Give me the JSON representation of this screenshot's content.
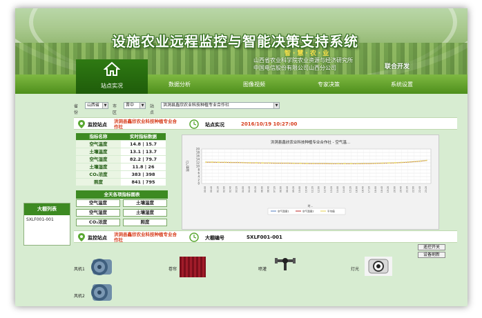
{
  "header": {
    "title": "设施农业远程监控与智能决策支持系统",
    "slogan": "智·慧·农·业",
    "org_line1": "山西省农业科学院农业资源与经济研究所",
    "org_line2": "中国电信股份有限公司山西分公司",
    "org_line3": "联合开发"
  },
  "nav": {
    "tabs": [
      {
        "label": "站点实况"
      },
      {
        "label": "数据分析"
      },
      {
        "label": "图像视频"
      },
      {
        "label": "专家决策"
      },
      {
        "label": "系统设置"
      }
    ]
  },
  "filters": {
    "province_label": "省份",
    "province_value": "山西省",
    "city_label": "市区",
    "city_value": "晋中",
    "site_label": "站点",
    "site_value": "洪洞县鑫欣农业科技种植专业合作社"
  },
  "monitor1": {
    "label": "监控站点",
    "site": "洪洞县鑫欣农业科技种植专业合作社",
    "live_label": "站点实况",
    "time": "2016/10/19 10:27:00"
  },
  "indicator_table": {
    "headers": [
      "指标名称",
      "实时指标数据"
    ],
    "rows": [
      {
        "name": "空气温度",
        "value": "14.8 | 15.7"
      },
      {
        "name": "土壤温度",
        "value": "13.1 | 13.7"
      },
      {
        "name": "空气湿度",
        "value": "82.2 | 79.7"
      },
      {
        "name": "土壤湿度",
        "value": "11.8 | 26"
      },
      {
        "name": "CO₂浓度",
        "value": "383 | 398"
      },
      {
        "name": "照度",
        "value": "841 | 795"
      }
    ]
  },
  "chart_section": {
    "title": "全天各项指标图表",
    "buttons": [
      "空气温度",
      "土壤温度",
      "空气湿度",
      "土壤湿度",
      "CO₂浓度",
      "照度"
    ]
  },
  "side_list": {
    "title": "大棚列表",
    "items": [
      "SXLF001-001"
    ]
  },
  "chart_data": {
    "type": "line",
    "title": "洪洞县鑫欣农业科技种植专业合作社 - 空气温...",
    "ylabel": "温度(°C)",
    "xlabel": "时...",
    "ylim": [
      0,
      20
    ],
    "yticks": [
      0,
      2,
      4,
      6,
      8,
      10,
      12,
      14,
      16,
      18,
      20
    ],
    "x": [
      "00:00",
      "00:40",
      "01:20",
      "02:00",
      "02:40",
      "03:20",
      "04:00",
      "04:40",
      "05:20",
      "06:00",
      "06:40",
      "07:20",
      "08:00",
      "08:40",
      "09:20",
      "10:00",
      "10:40",
      "11:20",
      "12:00",
      "12:40",
      "13:20",
      "14:00",
      "14:40",
      "15:20",
      "16:00",
      "16:40",
      "17:20",
      "18:00",
      "18:40",
      "19:20",
      "20:00",
      "20:40",
      "21:20",
      "22:00",
      "22:40",
      "23:20"
    ],
    "series": [
      {
        "name": "空气温度1",
        "color": "#6a8fc7",
        "values": [
          12.4,
          12.4,
          12.3,
          12.3,
          12.2,
          12.2,
          12.1,
          12.0,
          12.0,
          11.9,
          11.9,
          11.8,
          11.8,
          11.8,
          11.7,
          11.7,
          11.6,
          11.6,
          11.6,
          11.6,
          11.5,
          11.5,
          11.5,
          11.5,
          11.5,
          11.6,
          11.6,
          11.7,
          11.8,
          11.9,
          12.0,
          12.2,
          12.4,
          12.7,
          13.0,
          13.4
        ]
      },
      {
        "name": "空气温度2",
        "color": "#c64a4a",
        "values": [
          12.3,
          12.3,
          12.2,
          12.2,
          12.1,
          12.1,
          12.0,
          11.9,
          11.9,
          11.8,
          11.8,
          11.7,
          11.7,
          11.7,
          11.6,
          11.6,
          11.5,
          11.5,
          11.5,
          11.5,
          11.4,
          11.4,
          11.4,
          11.4,
          11.4,
          11.5,
          11.5,
          11.6,
          11.7,
          11.8,
          11.9,
          12.1,
          12.3,
          12.6,
          12.9,
          13.3
        ]
      },
      {
        "name": "平均值",
        "color": "#e8d86a",
        "values": [
          12.4,
          12.4,
          12.3,
          12.3,
          12.2,
          12.2,
          12.1,
          12.0,
          12.0,
          11.9,
          11.9,
          11.8,
          11.8,
          11.8,
          11.7,
          11.7,
          11.6,
          11.6,
          11.6,
          11.6,
          11.5,
          11.5,
          11.5,
          11.5,
          11.5,
          11.6,
          11.6,
          11.7,
          11.8,
          11.9,
          12.0,
          12.2,
          12.4,
          12.7,
          13.0,
          13.4
        ]
      }
    ],
    "legend": [
      "空气温度1",
      "空气温度2",
      "平均值"
    ],
    "grid": true,
    "legend_position": "bottom"
  },
  "monitor2": {
    "label": "监控站点",
    "site": "洪洞县鑫欣农业科技种植专业合作社",
    "shed_label": "大棚编号",
    "shed_id": "SXLF001-001",
    "btn1": "遥控开关",
    "btn2": "设备刷新"
  },
  "devices": {
    "fan1_label": "风机1",
    "fan2_label": "风机2",
    "curtain_label": "卷帘",
    "sprinkler_label": "喷灌",
    "light_label": "灯光"
  }
}
